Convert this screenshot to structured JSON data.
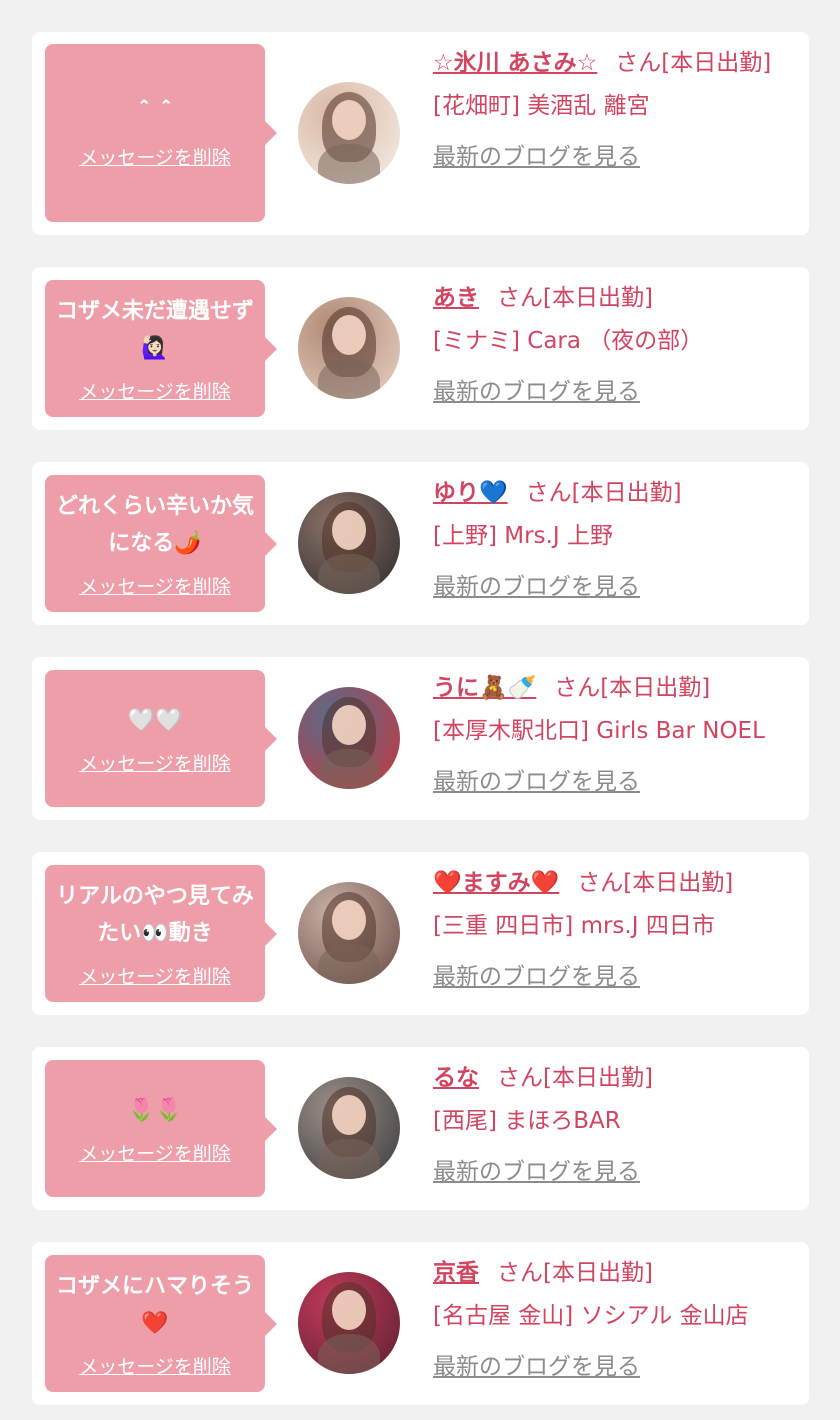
{
  "cards": [
    {
      "message": "＾＾",
      "delete_label": "メッセージを削除",
      "name": "☆氷川 あさみ☆",
      "name_suffix": "さん[本日出勤]",
      "shop": "[花畑町] 美酒乱 離宮",
      "blog_label": "最新のブログを見る",
      "avatar_colors": [
        "#f6efe8",
        "#d8b9a4"
      ]
    },
    {
      "message": "コザメ未だ遭遇せず🙋🏻‍♀️",
      "delete_label": "メッセージを削除",
      "name": "あき",
      "name_suffix": "さん[本日出勤]",
      "shop": "[ミナミ] Cara （夜の部）",
      "blog_label": "最新のブログを見る",
      "avatar_colors": [
        "#e8d2c6",
        "#b08a74"
      ]
    },
    {
      "message": "どれくらい辛いか気になる🌶️",
      "delete_label": "メッセージを削除",
      "name": "ゆり💙",
      "name_suffix": "さん[本日出勤]",
      "shop": "[上野] Mrs.J 上野",
      "blog_label": "最新のブログを見る",
      "avatar_colors": [
        "#2d2a2c",
        "#8a7266"
      ]
    },
    {
      "message": "🤍🤍",
      "delete_label": "メッセージを削除",
      "name": "うに🧸🍼",
      "name_suffix": "さん[本日出勤]",
      "shop": "[本厚木駅北口] Girls Bar NOEL",
      "blog_label": "最新のブログを見る",
      "avatar_colors": [
        "#c8383d",
        "#5a6b8a"
      ]
    },
    {
      "message": "リアルのやつ見てみたい👀動き",
      "delete_label": "メッセージを削除",
      "name": "❤️ますみ❤️",
      "name_suffix": "さん[本日出勤]",
      "shop": "[三重 四日市] mrs.J 四日市",
      "blog_label": "最新のブログを見る",
      "avatar_colors": [
        "#6a4a44",
        "#c9b2a8"
      ]
    },
    {
      "message": "🌷🌷",
      "delete_label": "メッセージを削除",
      "name": "るな",
      "name_suffix": "さん[本日出勤]",
      "shop": "[西尾] まほろBAR",
      "blog_label": "最新のブログを見る",
      "avatar_colors": [
        "#3a3a3c",
        "#9a8f88"
      ]
    },
    {
      "message": "コザメにハマりそう❤️",
      "delete_label": "メッセージを削除",
      "name": "京香",
      "name_suffix": "さん[本日出勤]",
      "shop": "[名古屋 金山] ソシアル 金山店",
      "blog_label": "最新のブログを見る",
      "avatar_colors": [
        "#5a2030",
        "#c23a5a"
      ]
    }
  ]
}
